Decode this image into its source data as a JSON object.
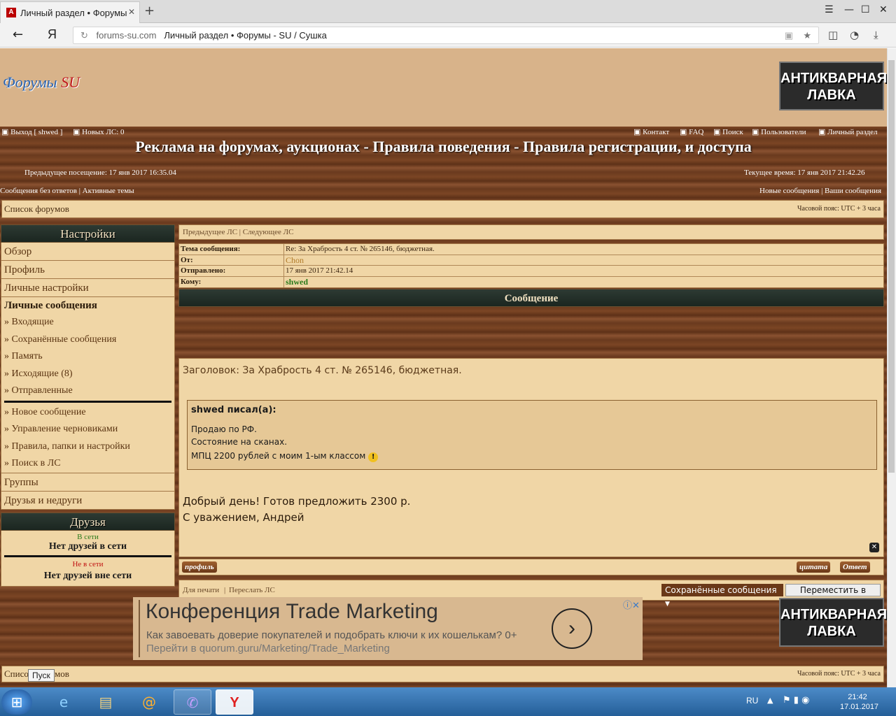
{
  "browser": {
    "tab_title": "Личный раздел • Форумы",
    "tab_icon": "A",
    "new_tab": "+",
    "url_domain": "forums-su.com",
    "url_title": "Личный раздел • Форумы - SU / Сушка",
    "yandex": "Я"
  },
  "forum": {
    "logo_text": "Форумы",
    "logo_su": "SU",
    "banner_line1": "АНТИКВАРНАЯ",
    "banner_line2": "ЛАВКА",
    "logout": "Выход [ shwed ]",
    "new_pm": "Новых ЛС: 0",
    "top_links": [
      "Контакт",
      "FAQ",
      "Поиск",
      "Пользователи",
      "Личный раздел"
    ],
    "title": "Реклама на форумах, аукционах - Правила поведения - Правила регистрации, и доступа",
    "last_visit": "Предыдущее посещение: 17 янв 2017 16:35.04",
    "current_time": "Текущее время: 17 янв 2017 21:42.26",
    "unanswered": "Сообщения без ответов",
    "active": "Активные темы",
    "new_msgs": "Новые сообщения",
    "your_msgs": "Ваши сообщения",
    "forum_list": "Список форумов",
    "timezone": "Часовой пояс: UTC + 3 часа"
  },
  "sidebar": {
    "head": "Настройки",
    "overview": "Обзор",
    "profile": "Профиль",
    "prefs": "Личные настройки",
    "pm_head": "Личные сообщения",
    "pm_items": [
      "» Входящие",
      "» Сохранённые сообщения",
      "» Память",
      "» Исходящие (8)",
      "» Отправленные"
    ],
    "pm_items2": [
      "» Новое сообщение",
      "» Управление черновиками",
      "» Правила, папки и настройки",
      "» Поиск в ЛС"
    ],
    "groups": "Группы",
    "friends_foes": "Друзья и недруги",
    "friends_head": "Друзья",
    "online": "В сети",
    "no_online": "Нет друзей в сети",
    "offline": "Не в сети",
    "no_offline": "Нет друзей вне сети"
  },
  "message": {
    "prev_next": "Предыдущее ЛС | Следующее ЛС",
    "rows": [
      {
        "k": "Тема сообщения:",
        "v": "Re: За Храбрость 4 ст. № 265146, бюджетная."
      },
      {
        "k": "От:",
        "v": "Chon"
      },
      {
        "k": "Отправлено:",
        "v": "17 янв 2017 21:42.14"
      },
      {
        "k": "Кому:",
        "v": "shwed"
      }
    ],
    "head": "Сообщение",
    "subject": "Заголовок: За Храбрость 4 ст. № 265146, бюджетная.",
    "quote_author": "shwed писал(а):",
    "quote_l1": "Продаю по РФ.",
    "quote_l2": "Состояние на сканах.",
    "quote_l3": "МПЦ 2200 рублей с моим 1-ым классом",
    "body1": "Добрый день! Готов предложить 2300 р.",
    "body2": "С уважением, Андрей",
    "profile_btn": "профиль",
    "quote_btn": "цитата",
    "reply_btn": "Ответ",
    "print": "Для печати",
    "forward": "Переслать ЛС",
    "folder": "Сохранённые сообщения",
    "move": "Переместить в папку"
  },
  "ad": {
    "title": "Конференция Trade Marketing",
    "line1": "Как завоевать доверие покупателей и подобрать ключи к их кошелькам? 0+",
    "line2": "Перейти в quorum.guru/Marketing/Trade_Marketing"
  },
  "footer": {
    "forum_list": "Список форумов",
    "timezone": "Часовой пояс: UTC + 3 часа"
  },
  "taskbar": {
    "tooltip": "Пуск",
    "lang": "RU",
    "time": "21:42",
    "date": "17.01.2017"
  }
}
